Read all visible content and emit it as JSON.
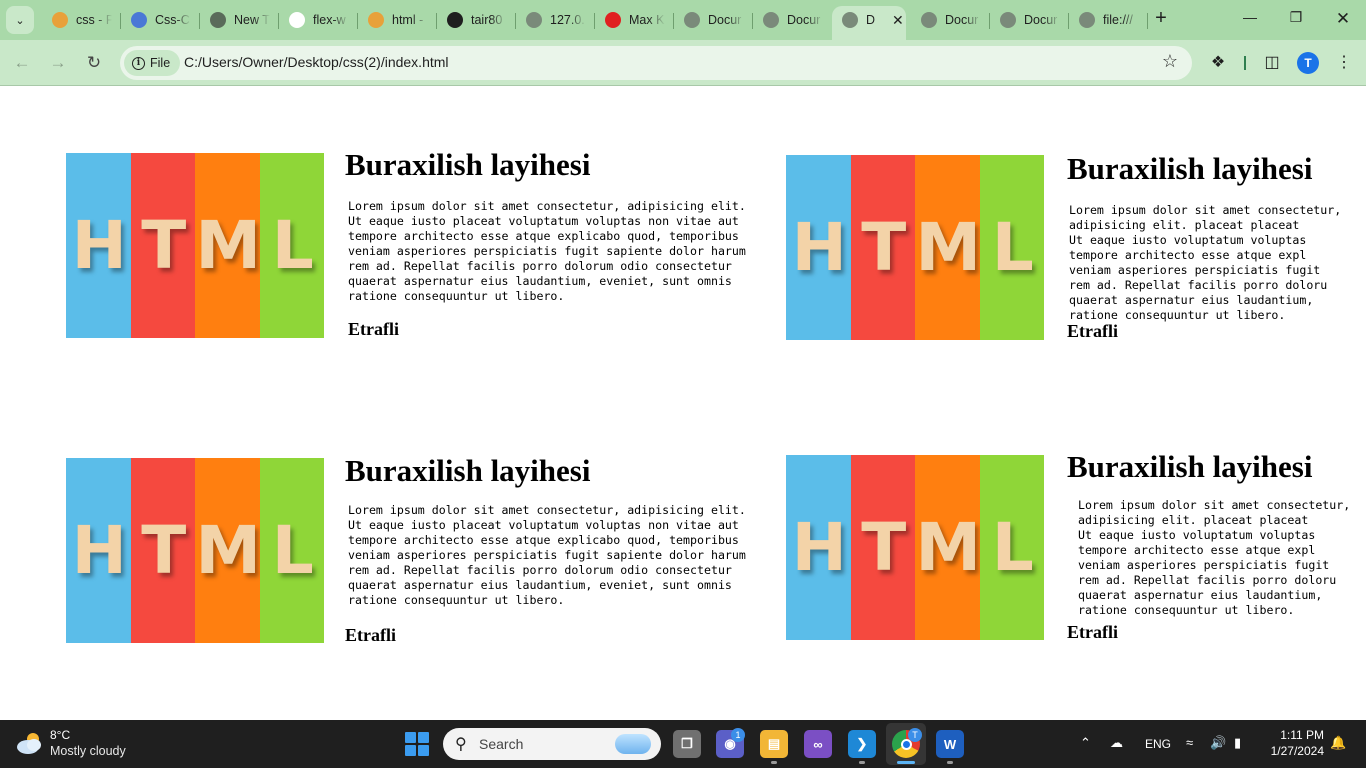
{
  "browser": {
    "tabs": [
      {
        "title": "css - P",
        "icon": "css-icon",
        "color": "#e8a13a"
      },
      {
        "title": "Css-C",
        "icon": "classroom-icon",
        "color": "#4a78d6"
      },
      {
        "title": "New T",
        "icon": "chrome-icon",
        "color": "#5a6b5a"
      },
      {
        "title": "flex-w",
        "icon": "google-icon",
        "color": "#ffffff"
      },
      {
        "title": "html -",
        "icon": "html-icon",
        "color": "#e8a13a"
      },
      {
        "title": "tair80",
        "icon": "github-icon",
        "color": "#1f1f1f"
      },
      {
        "title": "127.0.",
        "icon": "globe-icon",
        "color": "#7a8a7a"
      },
      {
        "title": "Max K",
        "icon": "youtube-icon",
        "color": "#e02020"
      },
      {
        "title": "Docur",
        "icon": "globe-icon",
        "color": "#7a8a7a"
      },
      {
        "title": "Docur",
        "icon": "globe-icon",
        "color": "#7a8a7a"
      },
      {
        "title": "D",
        "icon": "globe-icon",
        "color": "#7a8a7a",
        "active": true
      },
      {
        "title": "Docur",
        "icon": "globe-icon",
        "color": "#7a8a7a"
      },
      {
        "title": "Docur",
        "icon": "globe-icon",
        "color": "#7a8a7a"
      },
      {
        "title": "file:///",
        "icon": "globe-icon",
        "color": "#7a8a7a"
      }
    ],
    "address_chip": "File",
    "url": "C:/Users/Owner/Desktop/css(2)/index.html",
    "profile_initial": "T",
    "theme_color": "#a9d9a9"
  },
  "cards": [
    {
      "image_letters": [
        "H",
        "T",
        "M",
        "L"
      ],
      "title": "Buraxilish layihesi",
      "text": "Lorem ipsum dolor sit amet consectetur, adipisicing elit.\nUt eaque iusto placeat voluptatum voluptas non vitae aut\ntempore architecto esse atque explicabo quod, temporibus\nveniam asperiores perspiciatis fugit sapiente dolor harum\nrem ad. Repellat facilis porro dolorum odio consectetur\nquaerat aspernatur eius laudantium, eveniet, sunt omnis\nratione consequuntur ut libero.",
      "link": "Etrafli"
    },
    {
      "image_letters": [
        "H",
        "T",
        "M",
        "L"
      ],
      "title": "Buraxilish layihesi",
      "text": "Lorem ipsum dolor sit amet consectetur,\nadipisicing elit. placeat placeat\nUt eaque iusto voluptatum voluptas\ntempore architecto esse atque expl\nveniam asperiores perspiciatis fugit\nrem ad. Repellat facilis porro doloru\nquaerat aspernatur eius laudantium,\nratione consequuntur ut libero.",
      "link": "Etrafli"
    },
    {
      "image_letters": [
        "H",
        "T",
        "M",
        "L"
      ],
      "title": "Buraxilish layihesi",
      "text": "Lorem ipsum dolor sit amet consectetur, adipisicing elit.\nUt eaque iusto placeat voluptatum voluptas non vitae aut\ntempore architecto esse atque explicabo quod, temporibus\nveniam asperiores perspiciatis fugit sapiente dolor harum\nrem ad. Repellat facilis porro dolorum odio consectetur\nquaerat aspernatur eius laudantium, eveniet, sunt omnis\nratione consequuntur ut libero.",
      "link": "Etrafli"
    },
    {
      "image_letters": [
        "H",
        "T",
        "M",
        "L"
      ],
      "title": "Buraxilish layihesi",
      "text": "Lorem ipsum dolor sit amet consectetur,\nadipisicing elit. placeat placeat\nUt eaque iusto voluptatum voluptas\ntempore architecto esse atque expl\nveniam asperiores perspiciatis fugit\nrem ad. Repellat facilis porro doloru\nquaerat aspernatur eius laudantium,\nratione consequuntur ut libero.",
      "link": "Etrafli"
    }
  ],
  "image_stripe_colors": [
    "#5bbde9",
    "#f5493f",
    "#ff7f10",
    "#8fd638"
  ],
  "taskbar": {
    "weather_temp": "8°C",
    "weather_desc": "Mostly cloudy",
    "search_placeholder": "Search",
    "teams_badge": "1",
    "chrome_badge": "T",
    "language": "ENG",
    "time": "1:11 PM",
    "date": "1/27/2024"
  }
}
